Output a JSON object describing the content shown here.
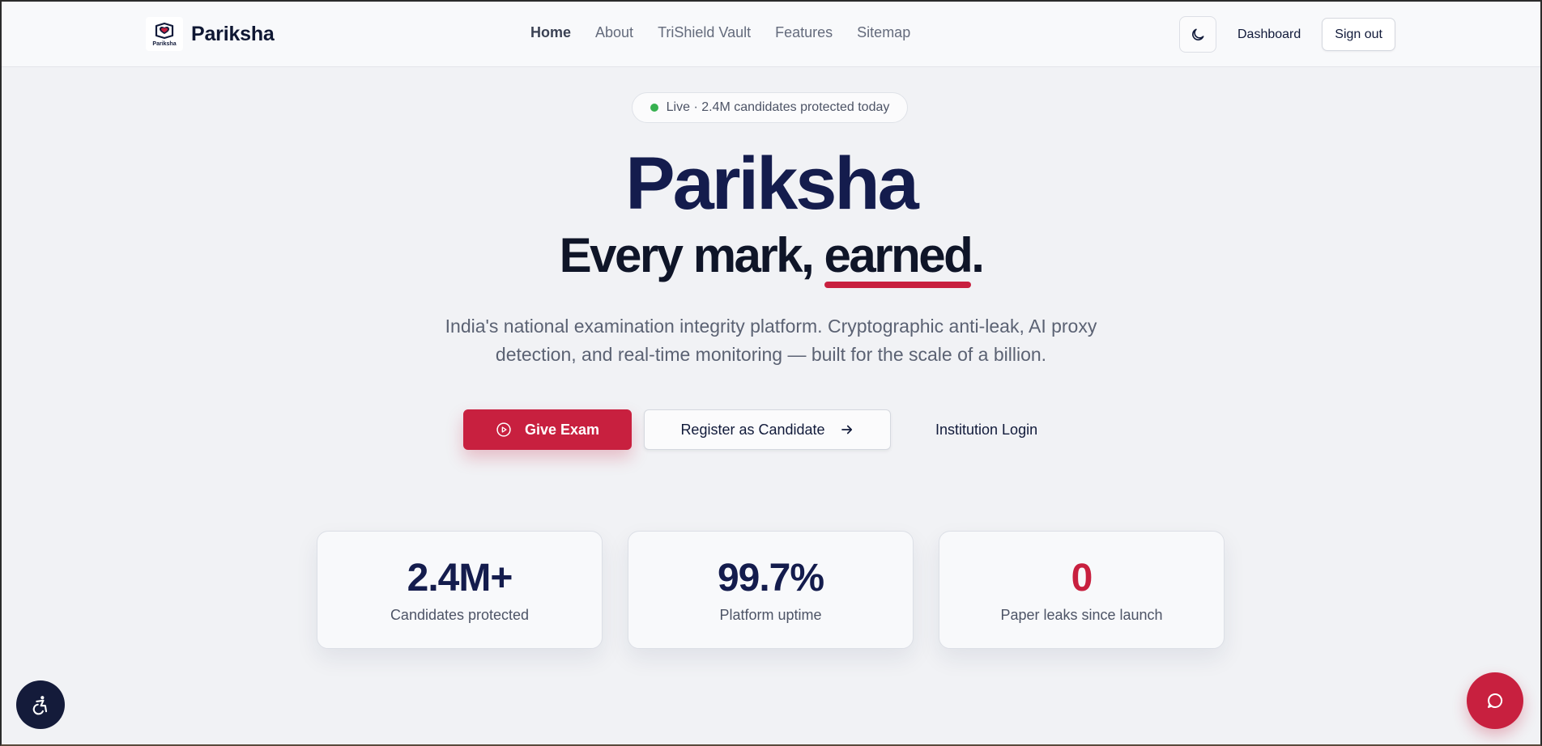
{
  "nav": {
    "brand_name": "Pariksha",
    "logo_text": "Pariksha",
    "links": [
      {
        "label": "Home",
        "active": true
      },
      {
        "label": "About"
      },
      {
        "label": "TriShield Vault"
      },
      {
        "label": "Features"
      },
      {
        "label": "Sitemap"
      }
    ],
    "theme_icon": "moon-icon",
    "dashboard_label": "Dashboard",
    "signout_label": "Sign out"
  },
  "hero": {
    "live_text": "Live · 2.4M candidates protected today",
    "title": "Pariksha",
    "tagline_pre": "Every mark, ",
    "tagline_emphasis": "earned",
    "tagline_post": ".",
    "description": "India's national examination integrity platform. Cryptographic anti-leak, AI proxy detection, and real-time monitoring — built for the scale of a billion."
  },
  "cta": {
    "primary_label": "Give Exam",
    "primary_icon": "play-circle-icon",
    "secondary_label": "Register as Candidate",
    "secondary_icon": "arrow-right-icon",
    "tertiary_label": "Institution Login"
  },
  "stats": [
    {
      "value": "2.4M+",
      "label": "Candidates protected"
    },
    {
      "value": "99.7%",
      "label": "Platform uptime"
    },
    {
      "value": "0",
      "label": "Paper leaks since launch"
    }
  ],
  "colors": {
    "accent": "#c8203f",
    "navy": "#141c4d",
    "live": "#36b04f"
  },
  "floating": {
    "accessibility_icon": "accessibility-icon",
    "chat_icon": "chat-bubble-icon"
  }
}
